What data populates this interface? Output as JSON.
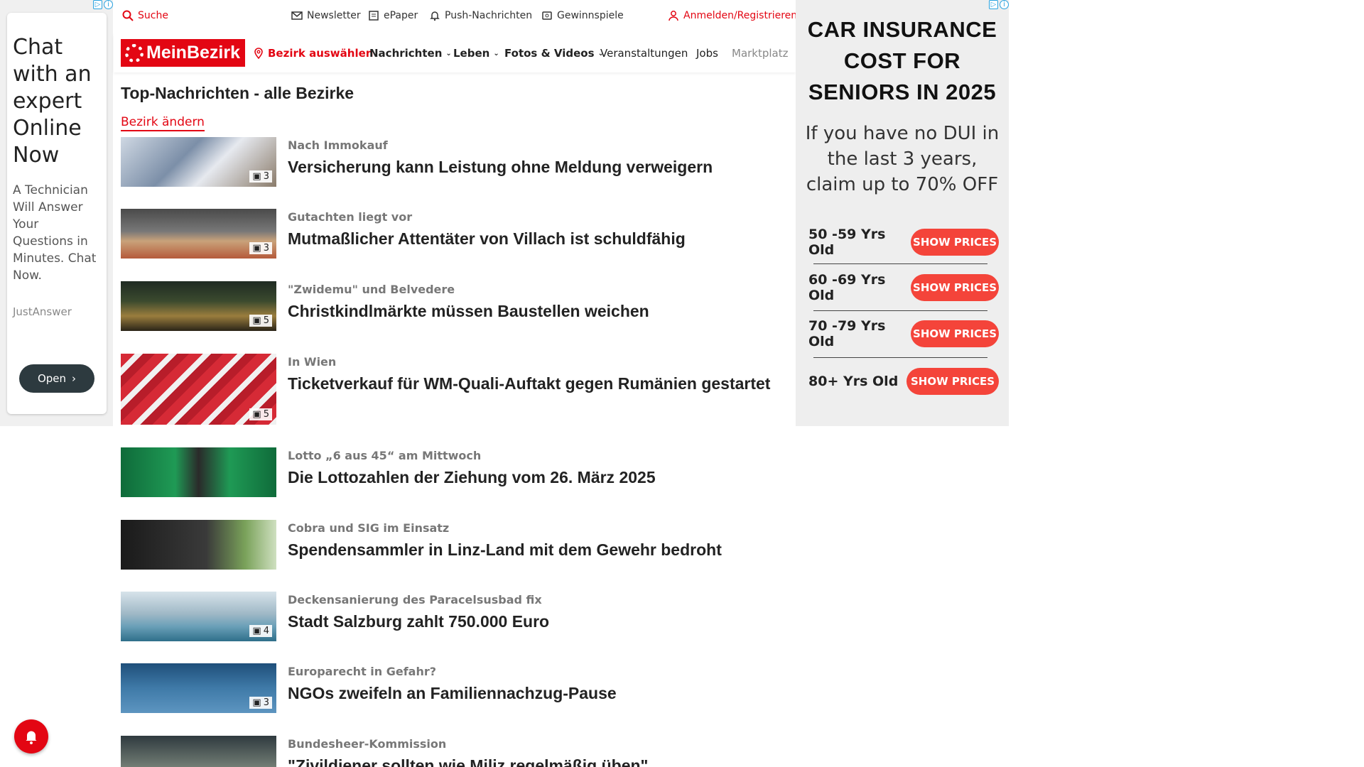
{
  "left_ad": {
    "headline": "Chat with an expert Online Now",
    "body": "A Technician Will Answer Your Questions in Minutes. Chat Now.",
    "brand": "JustAnswer",
    "button": "Open"
  },
  "topbar": {
    "search": "Suche",
    "newsletter": "Newsletter",
    "epaper": "ePaper",
    "push": "Push-Nachrichten",
    "games": "Gewinnspiele",
    "login": "Anmelden/Registrieren"
  },
  "nav": {
    "logo": "MeinBezirk",
    "select_district": "Bezirk auswählen",
    "items": [
      "Nachrichten",
      "Leben",
      "Fotos & Videos",
      "Veranstaltungen",
      "Jobs",
      "Marktplatz"
    ]
  },
  "main": {
    "title": "Top-Nachrichten - alle Bezirke",
    "change_district": "Bezirk ändern",
    "articles": [
      {
        "kicker": "Nach Immokauf",
        "title": "Versicherung kann Leistung ohne Meldung verweigern",
        "count": "3"
      },
      {
        "kicker": "Gutachten liegt vor",
        "title": "Mutmaßlicher Attentäter von Villach ist schuldfähig",
        "count": "3"
      },
      {
        "kicker": "\"Zwidemu\" und Belvedere",
        "title": "Christkindlmärkte müssen Baustellen weichen",
        "count": "5"
      },
      {
        "kicker": "In Wien",
        "title": "Ticketverkauf für WM-Quali-Auftakt gegen Rumänien gestartet",
        "count": "5"
      },
      {
        "kicker": "Lotto „6 aus 45“ am Mittwoch",
        "title": "Die Lottozahlen der Ziehung vom 26. März 2025",
        "count": ""
      },
      {
        "kicker": "Cobra und SIG im Einsatz",
        "title": "Spendensammler in Linz-Land mit dem Gewehr bedroht",
        "count": ""
      },
      {
        "kicker": "Deckensanierung des Paracelsusbad fix",
        "title": "Stadt Salzburg zahlt 750.000 Euro",
        "count": "4"
      },
      {
        "kicker": "Europarecht in Gefahr?",
        "title": "NGOs zweifeln an Familiennachzug-Pause",
        "count": "3"
      },
      {
        "kicker": "Bundesheer-Kommission",
        "title": "\"Zivildiener sollten wie Miliz regelmäßig üben\"",
        "count": ""
      }
    ]
  },
  "right_ad": {
    "headline": "CAR INSURANCE COST FOR SENIORS IN 2025",
    "sub": "If you have no DUI in the last 3 years, claim up to 70% OFF",
    "rows": [
      {
        "age": "50 -59 Yrs Old",
        "button": "SHOW PRICES"
      },
      {
        "age": "60 -69 Yrs Old",
        "button": "SHOW PRICES"
      },
      {
        "age": "70 -79 Yrs Old",
        "button": "SHOW PRICES"
      },
      {
        "age": "80+ Yrs Old",
        "button": "SHOW PRICES"
      }
    ]
  },
  "colors": {
    "brand_red": "#e30613",
    "ad_button": "#f4443a"
  }
}
